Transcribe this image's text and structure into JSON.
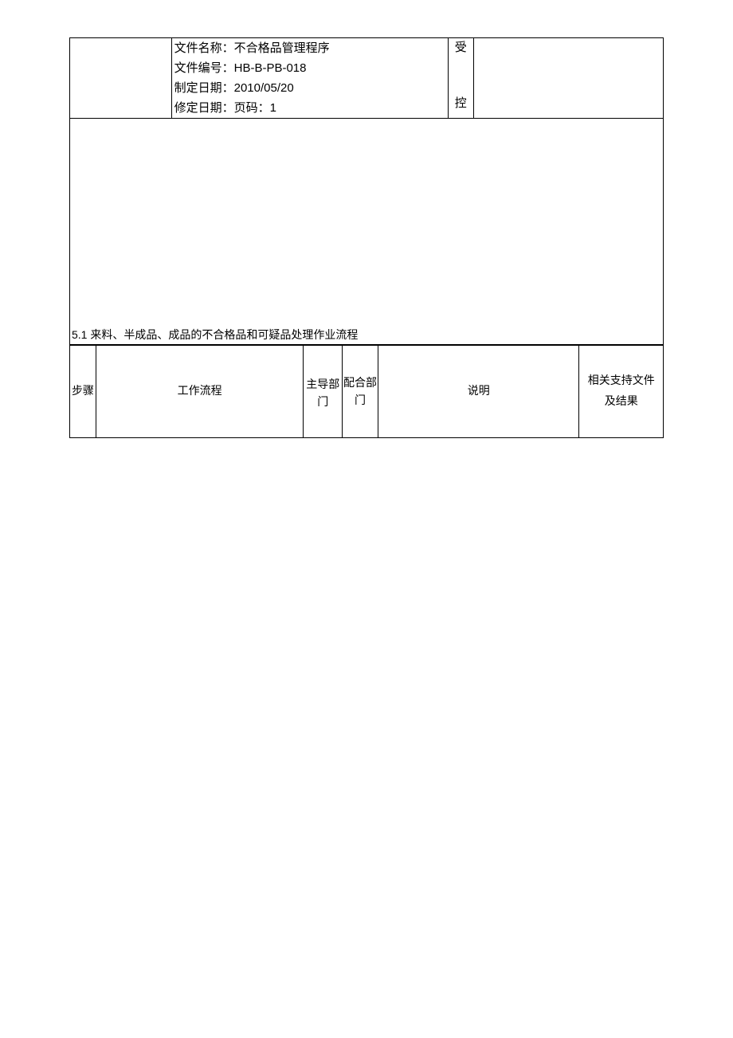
{
  "header": {
    "file_name_label": "文件名称：",
    "file_name": "不合格品管理程序",
    "file_no_label": "文件编号：",
    "file_no": "HB-B-PB-018",
    "create_date_label": "制定日期：",
    "create_date": "2010/05/20",
    "revise_date_label": "修定日期：",
    "page_label": "页码：",
    "page_no": "1",
    "stamp_char1": "受",
    "stamp_char2": "控"
  },
  "section": {
    "num": "5.1",
    "title": " 来料、半成品、成品的不合格品和可疑品处理作业流程"
  },
  "table": {
    "col_step": "步骤",
    "col_flow": "工作流程",
    "col_lead": "主导部门",
    "col_coop": "配合部门",
    "col_desc": "说明",
    "col_doc": "相关支持文件及结果"
  }
}
